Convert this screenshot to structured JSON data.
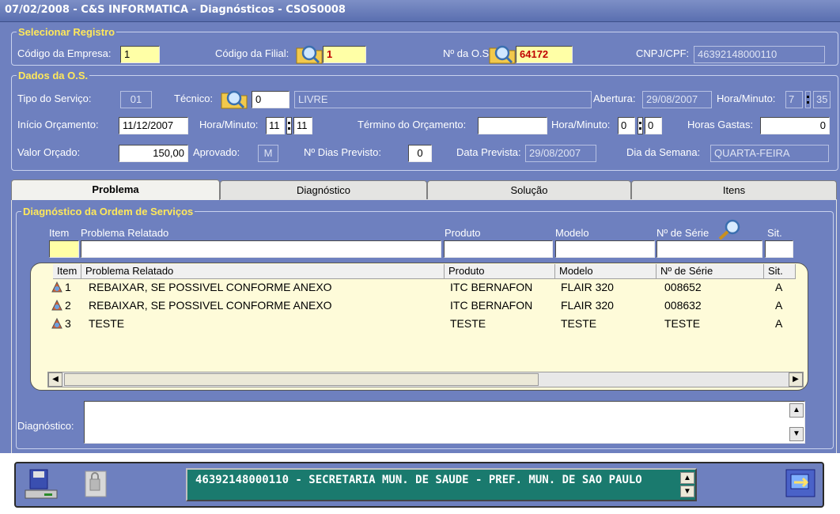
{
  "window": {
    "title": "07/02/2008 - C&S INFORMATICA - Diagnósticos - CSOS0008"
  },
  "selecionar": {
    "legend": "Selecionar Registro",
    "empresa_label": "Código da Empresa:",
    "empresa_value": "1",
    "filial_label": "Código da Filial:",
    "filial_value": "1",
    "os_label": "Nº da O.S.:",
    "os_value": "64172",
    "cnpj_label": "CNPJ/CPF:",
    "cnpj_value": "46392148000110"
  },
  "dados": {
    "legend": "Dados da O.S.",
    "tipo_label": "Tipo do Serviço:",
    "tipo_value": "01",
    "tecnico_label": "Técnico:",
    "tecnico_code": "0",
    "tecnico_name": "LIVRE",
    "abertura_label": "Abertura:",
    "abertura_value": "29/08/2007",
    "hora1_label": "Hora/Minuto:",
    "hora1_h": "7",
    "hora1_m": "35",
    "inicio_label": "Início Orçamento:",
    "inicio_value": "11/12/2007",
    "hora2_label": "Hora/Minuto:",
    "hora2_h": "11",
    "hora2_m": "11",
    "termino_label": "Término do Orçamento:",
    "termino_value": "",
    "hora3_label": "Hora/Minuto:",
    "hora3_h": "0",
    "hora3_m": "0",
    "horas_label": "Horas Gastas:",
    "horas_value": "0",
    "valor_label": "Valor Orçado:",
    "valor_value": "150,00",
    "aprovado_label": "Aprovado:",
    "aprovado_value": "M",
    "dias_label": "Nº Dias Previsto:",
    "dias_value": "0",
    "prevista_label": "Data Prevista:",
    "prevista_value": "29/08/2007",
    "semana_label": "Dia da Semana:",
    "semana_value": "QUARTA-FEIRA"
  },
  "tabs": [
    {
      "label": "Problema",
      "active": true
    },
    {
      "label": "Diagnóstico",
      "active": false
    },
    {
      "label": "Solução",
      "active": false
    },
    {
      "label": "Itens",
      "active": false
    }
  ],
  "diag": {
    "legend": "Diagnóstico da Ordem de Serviços",
    "filter_headers": [
      "Item",
      "Problema Relatado",
      "Produto",
      "Modelo",
      "Nº de Série",
      "Sit."
    ],
    "columns": [
      "Item",
      "Problema Relatado",
      "Produto",
      "Modelo",
      "Nº de Série",
      "Sit."
    ],
    "rows": [
      {
        "item": "1",
        "problema": "REBAIXAR, SE POSSIVEL CONFORME ANEXO",
        "produto": "ITC BERNAFON",
        "modelo": "FLAIR 320",
        "serie": "008652",
        "sit": "A"
      },
      {
        "item": "2",
        "problema": "REBAIXAR, SE POSSIVEL CONFORME ANEXO",
        "produto": "ITC BERNAFON",
        "modelo": "FLAIR 320",
        "serie": "008632",
        "sit": "A"
      },
      {
        "item": "3",
        "problema": "TESTE",
        "produto": "TESTE",
        "modelo": "TESTE",
        "serie": "TESTE",
        "sit": "A"
      }
    ],
    "diagnostico_label": "Diagnóstico:",
    "diagnostico_value": ""
  },
  "footer": {
    "status_text": "46392148000110 - SECRETARIA MUN. DE SAUDE - PREF. MUN. DE SAO PAULO"
  },
  "icons": [
    "save-icon",
    "lock-icon",
    "search-icon",
    "row-icon",
    "exit-icon"
  ]
}
